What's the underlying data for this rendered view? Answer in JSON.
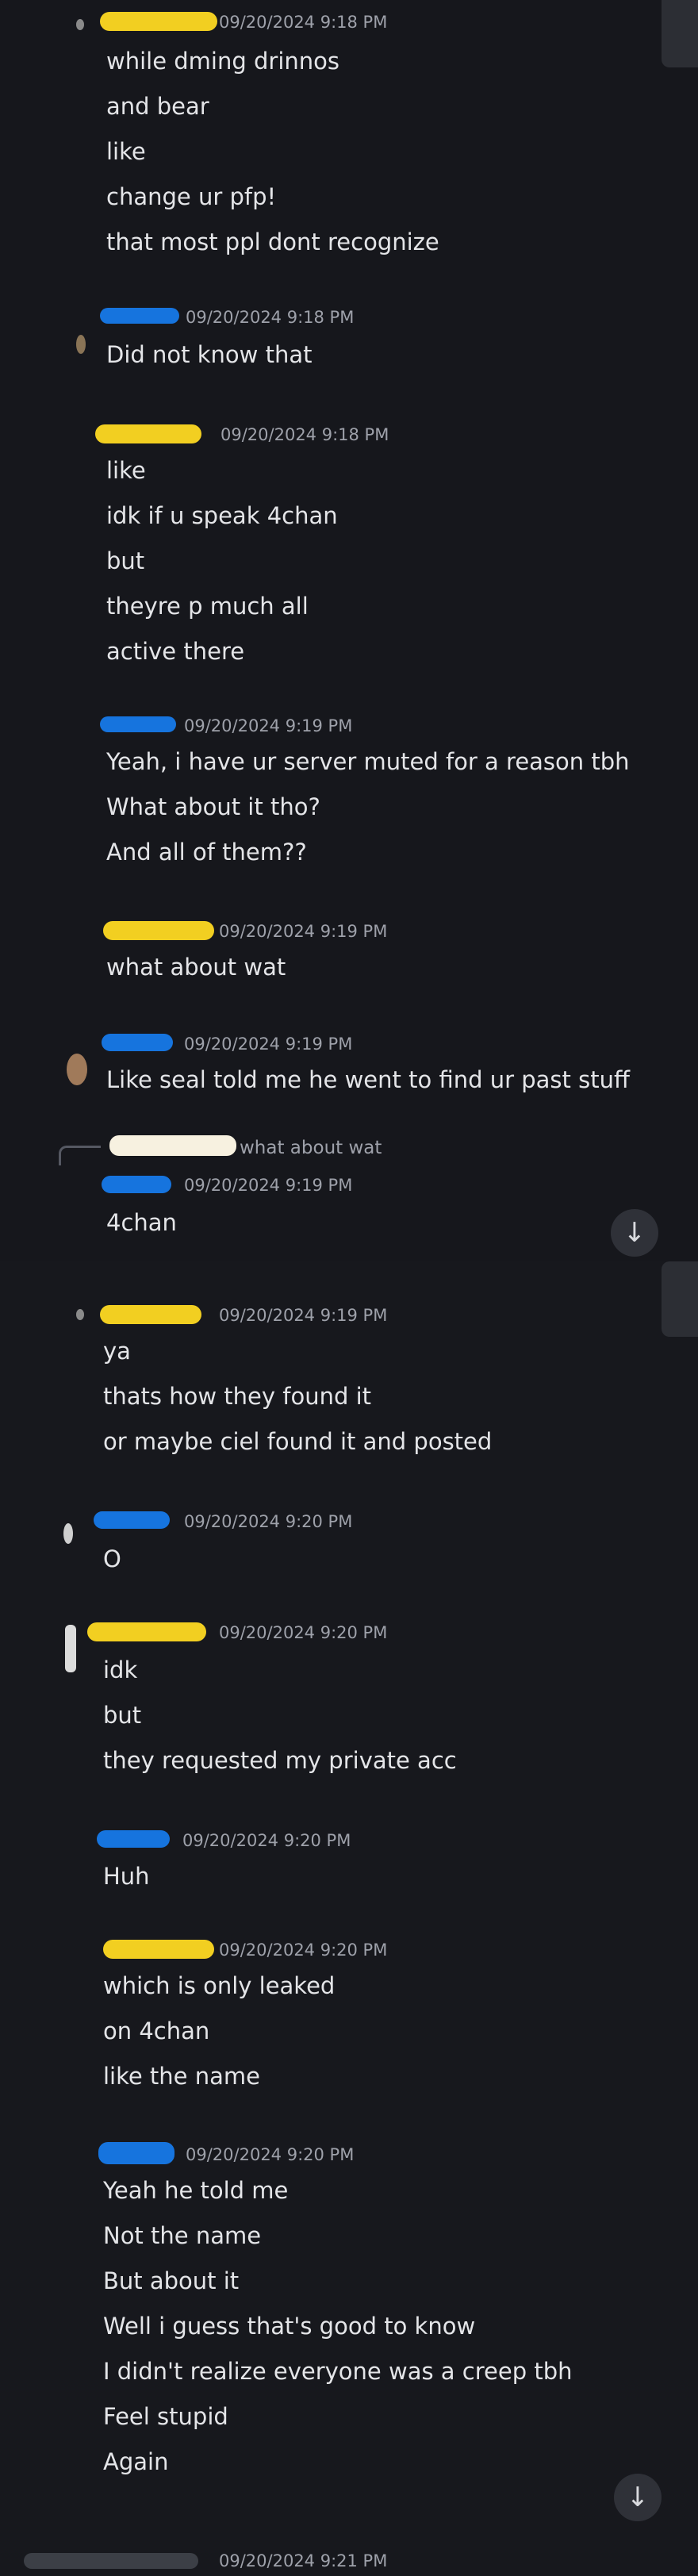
{
  "colors": {
    "background": "#16171c",
    "text": "#e4e5e8",
    "timestamp": "#9ea1aa",
    "redact_yellow": "#f2cf21",
    "redact_blue": "#1674de"
  },
  "top": {
    "messages": [
      {
        "time": "09/20/2024 9:18 PM",
        "lines": [
          "while dming drinnos",
          "and bear",
          "like",
          "change ur pfp!",
          "that most ppl dont recognize"
        ]
      },
      {
        "time": "09/20/2024 9:18 PM",
        "lines": [
          "Did not know that"
        ]
      },
      {
        "time": "09/20/2024 9:18 PM",
        "lines": [
          "like",
          "idk if u speak 4chan",
          "but",
          "theyre p much all",
          "active there"
        ]
      },
      {
        "time": "09/20/2024 9:19 PM",
        "lines": [
          "Yeah, i have ur server muted for a reason tbh",
          "What about it tho?",
          "And all of them??"
        ]
      },
      {
        "time": "09/20/2024 9:19 PM",
        "lines": [
          "what about wat"
        ]
      },
      {
        "time": "09/20/2024 9:19 PM",
        "lines": [
          "Like seal told me he went to find ur past stuff"
        ]
      },
      {
        "reply_text": "what about wat",
        "time": "09/20/2024 9:19 PM",
        "lines": [
          "4chan"
        ]
      }
    ],
    "jump_icon": "↓"
  },
  "bottom": {
    "messages": [
      {
        "time": "09/20/2024 9:19 PM",
        "lines": [
          "ya",
          "thats how they found it",
          "or maybe ciel found it and posted"
        ]
      },
      {
        "time": "09/20/2024 9:20 PM",
        "lines": [
          "O"
        ]
      },
      {
        "time": "09/20/2024 9:20 PM",
        "lines": [
          "idk",
          "but",
          "they requested my private acc"
        ]
      },
      {
        "time": "09/20/2024 9:20 PM",
        "lines": [
          "Huh"
        ]
      },
      {
        "time": "09/20/2024 9:20 PM",
        "lines": [
          "which is only leaked",
          "on 4chan",
          "like the name"
        ]
      },
      {
        "time": "09/20/2024 9:20 PM",
        "lines": [
          "Yeah he told me",
          "Not the name",
          "But about it",
          "Well i guess that's good to know",
          "I didn't realize everyone was a creep tbh",
          "Feel stupid",
          "Again"
        ]
      },
      {
        "time": "09/20/2024 9:21 PM",
        "lines": []
      }
    ],
    "jump_icon": "↓"
  }
}
